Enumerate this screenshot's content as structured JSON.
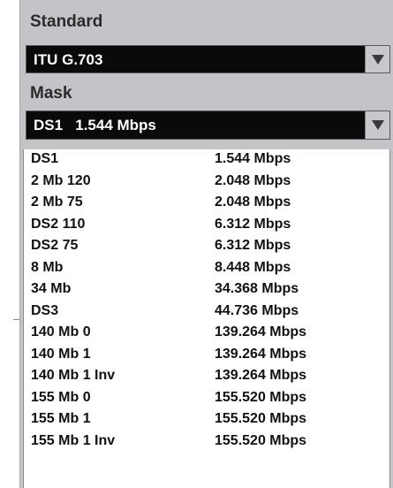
{
  "standard": {
    "label": "Standard",
    "selected": "ITU G.703"
  },
  "mask": {
    "label": "Mask",
    "selected": "DS1   1.544 Mbps",
    "options": [
      {
        "name": "DS1",
        "rate": "1.544 Mbps"
      },
      {
        "name": "2 Mb 120",
        "rate": "2.048 Mbps"
      },
      {
        "name": "2 Mb 75",
        "rate": "2.048 Mbps"
      },
      {
        "name": "DS2 110",
        "rate": "6.312 Mbps"
      },
      {
        "name": "DS2 75",
        "rate": "6.312 Mbps"
      },
      {
        "name": "8 Mb",
        "rate": "8.448 Mbps"
      },
      {
        "name": "34 Mb",
        "rate": "34.368 Mbps"
      },
      {
        "name": "DS3",
        "rate": "44.736 Mbps"
      },
      {
        "name": "140 Mb 0",
        "rate": "139.264 Mbps"
      },
      {
        "name": "140 Mb 1",
        "rate": "139.264 Mbps"
      },
      {
        "name": "140 Mb 1 Inv",
        "rate": "139.264 Mbps"
      },
      {
        "name": "155 Mb 0",
        "rate": "155.520 Mbps"
      },
      {
        "name": "155 Mb 1",
        "rate": "155.520 Mbps"
      },
      {
        "name": "155 Mb 1 Inv",
        "rate": "155.520 Mbps"
      }
    ]
  },
  "icons": {
    "dropdown_arrow": "chevron-down-icon"
  }
}
